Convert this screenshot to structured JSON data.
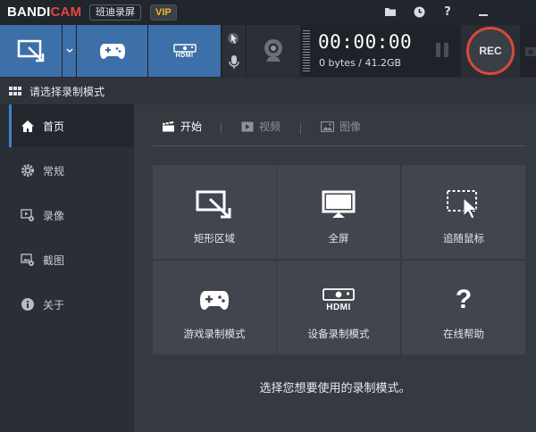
{
  "titlebar": {
    "logo_bandi": "BANDI",
    "logo_cam": "CAM",
    "app_name": "班迪录屏",
    "vip": "VIP",
    "icons": [
      "folder-icon",
      "clock-icon",
      "help-icon",
      "minimize-icon"
    ],
    "help_glyph": "?"
  },
  "toolbar": {
    "hdmi": "HDMI",
    "timer": "00:00:00",
    "size": "0 bytes / 41.2GB",
    "rec": "REC"
  },
  "header": {
    "title": "请选择录制模式"
  },
  "sidebar": {
    "items": [
      {
        "label": "首页",
        "icon": "home-icon",
        "active": true
      },
      {
        "label": "常规",
        "icon": "gear-icon",
        "active": false
      },
      {
        "label": "录像",
        "icon": "video-settings-icon",
        "active": false
      },
      {
        "label": "截图",
        "icon": "image-settings-icon",
        "active": false
      },
      {
        "label": "关于",
        "icon": "info-icon",
        "active": false
      }
    ]
  },
  "tabs": [
    {
      "label": "开始",
      "icon": "clapperboard-icon",
      "active": true
    },
    {
      "label": "视频",
      "icon": "play-icon",
      "active": false
    },
    {
      "label": "图像",
      "icon": "picture-icon",
      "active": false
    }
  ],
  "tiles": [
    {
      "label": "矩形区域",
      "icon": "rectangle-area-icon"
    },
    {
      "label": "全屏",
      "icon": "fullscreen-monitor-icon"
    },
    {
      "label": "追随鼠标",
      "icon": "follow-mouse-icon"
    },
    {
      "label": "游戏录制模式",
      "icon": "gamepad-icon"
    },
    {
      "label": "设备录制模式",
      "icon": "hdmi-device-icon"
    },
    {
      "label": "在线帮助",
      "icon": "help-icon"
    }
  ],
  "help_glyph": "?",
  "footer": {
    "text": "选择您想要使用的录制模式。"
  },
  "colors": {
    "accent_blue": "#3d6fa8",
    "rec_red": "#d9483c",
    "vip_gold": "#f3b92e"
  }
}
